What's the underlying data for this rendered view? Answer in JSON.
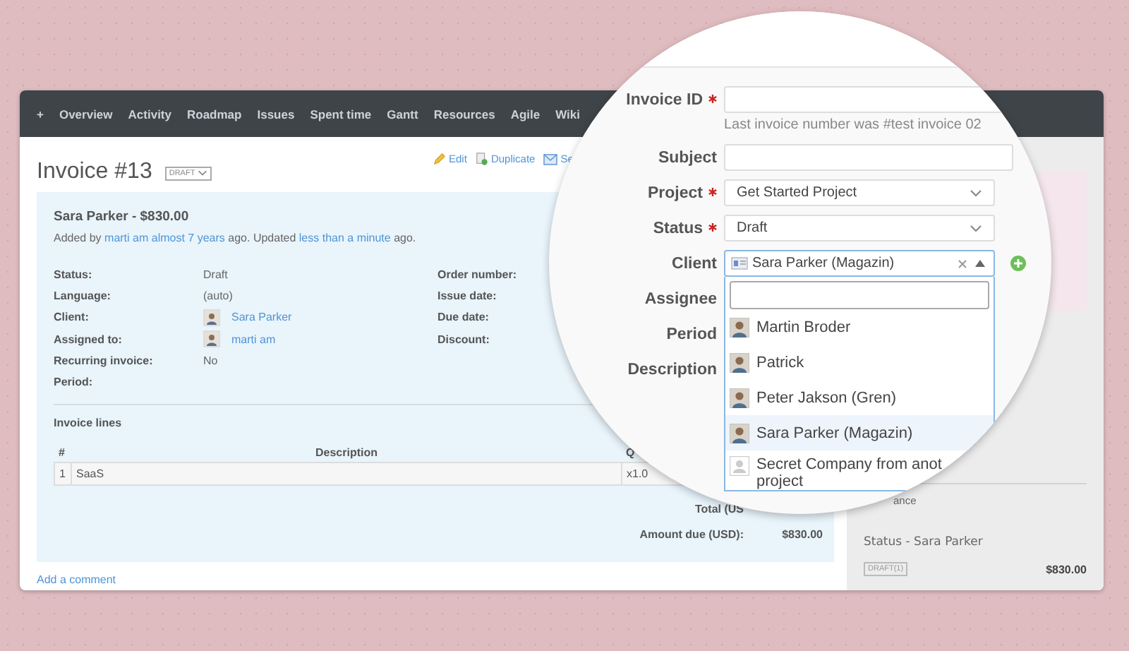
{
  "nav": {
    "items": [
      "+",
      "Overview",
      "Activity",
      "Roadmap",
      "Issues",
      "Spent time",
      "Gantt",
      "Resources",
      "Agile",
      "Wiki"
    ]
  },
  "invoice": {
    "title": "Invoice #13",
    "status_badge": "DRAFT",
    "actions": [
      {
        "label": "Edit"
      },
      {
        "label": "Duplicate"
      },
      {
        "label": "Se"
      }
    ],
    "summary": {
      "heading": "Sara Parker - $830.00",
      "added_prefix": "Added by",
      "author": "marti am",
      "age": "almost 7 years",
      "middle": "ago. Updated",
      "updated": "less than a minute",
      "suffix": "ago."
    },
    "attributes": [
      {
        "label": "Status:",
        "value": "Draft",
        "kind": "text"
      },
      {
        "label": "Language:",
        "value": "(auto)",
        "kind": "text"
      },
      {
        "label": "Client:",
        "value": "Sara Parker",
        "kind": "user"
      },
      {
        "label": "Assigned to:",
        "value": "marti am",
        "kind": "user"
      },
      {
        "label": "Recurring invoice:",
        "value": "No",
        "kind": "text"
      },
      {
        "label": "Period:",
        "kind": "text"
      }
    ],
    "attributes_right": [
      "Order number:",
      "Issue date:",
      "Due date:",
      "Discount:"
    ],
    "lines": {
      "heading": "Invoice lines",
      "columns": [
        "#",
        "Description",
        "Q"
      ],
      "rows": [
        {
          "number": "1",
          "description": "SaaS",
          "quantity": "x1.0"
        }
      ]
    },
    "totals": {
      "total_label": "Total (US",
      "amount_due_label": "Amount due (USD):",
      "amount_due": "$830.00"
    },
    "add_comment": "Add a comment"
  },
  "sidebar": {
    "partial_heading": "ance",
    "entries": [
      {
        "title": "Status - Sara Parker",
        "badge": "DRAFT(1)",
        "amount": "$830.00"
      }
    ]
  },
  "form": {
    "fields": [
      {
        "label": "Invoice ID",
        "required": true,
        "kind": "text",
        "hint": "Last invoice number was #test invoice 02"
      },
      {
        "label": "Subject",
        "required": false,
        "kind": "text"
      },
      {
        "label": "Project",
        "required": true,
        "kind": "select",
        "value": "Get Started Project"
      },
      {
        "label": "Status",
        "required": true,
        "kind": "select",
        "value": "Draft"
      },
      {
        "label": "Client",
        "required": false,
        "kind": "combo",
        "value": "Sara Parker (Magazin)",
        "expanded": true
      },
      {
        "label": "Assignee",
        "required": false,
        "kind": "label"
      },
      {
        "label": "Period",
        "required": false,
        "kind": "label"
      },
      {
        "label": "Description",
        "required": false,
        "kind": "label"
      }
    ],
    "client_options": [
      {
        "label": "Martin Broder",
        "selected": false,
        "kind": "person"
      },
      {
        "label": "Patrick",
        "selected": false,
        "kind": "person"
      },
      {
        "label": "Peter Jakson (Gren)",
        "selected": false,
        "kind": "person"
      },
      {
        "label": "Sara Parker (Magazin)",
        "selected": true,
        "kind": "person"
      },
      {
        "label": "Secret Company from anot\nproject",
        "selected": false,
        "kind": "company"
      }
    ]
  }
}
